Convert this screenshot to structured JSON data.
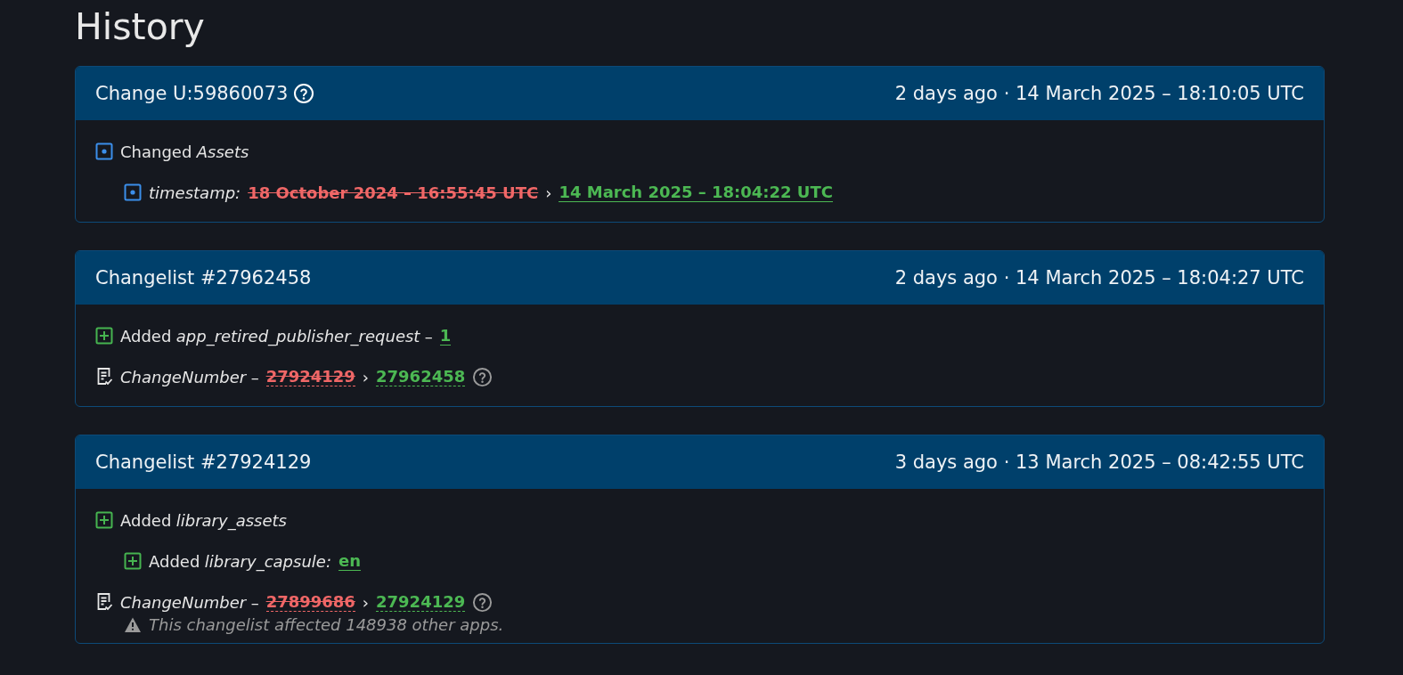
{
  "title": "History",
  "cards": [
    {
      "title": "Change U:59860073",
      "help": true,
      "time": "2 days ago · 14 March 2025 – 18:10:05 UTC",
      "lines": [
        {
          "kind": "changed",
          "verb": "Changed",
          "key": "Assets",
          "children": [
            {
              "kind": "changed",
              "key": "timestamp:",
              "old": "18 October 2024 – 16:55:45 UTC",
              "arrow": "›",
              "new": "14 March 2025 – 18:04:22 UTC"
            }
          ]
        }
      ]
    },
    {
      "title": "Changelist #27962458",
      "help": false,
      "time": "2 days ago · 14 March 2025 – 18:04:27 UTC",
      "lines": [
        {
          "kind": "added",
          "verb": "Added",
          "key": "app_retired_publisher_request",
          "sep": "–",
          "new": "1"
        },
        {
          "kind": "changenumber",
          "key": "ChangeNumber",
          "sep": "–",
          "old": "27924129",
          "arrow": "›",
          "new": "27962458",
          "help": true
        }
      ]
    },
    {
      "title": "Changelist #27924129",
      "help": false,
      "time": "3 days ago · 13 March 2025 – 08:42:55 UTC",
      "lines": [
        {
          "kind": "added",
          "verb": "Added",
          "key": "library_assets",
          "children": [
            {
              "kind": "added",
              "verb": "Added",
              "key": "library_capsule:",
              "new": "en"
            }
          ]
        },
        {
          "kind": "changenumber",
          "key": "ChangeNumber",
          "sep": "–",
          "old": "27899686",
          "arrow": "›",
          "new": "27924129",
          "help": true,
          "note": "This changelist affected 148938 other apps."
        }
      ]
    }
  ]
}
